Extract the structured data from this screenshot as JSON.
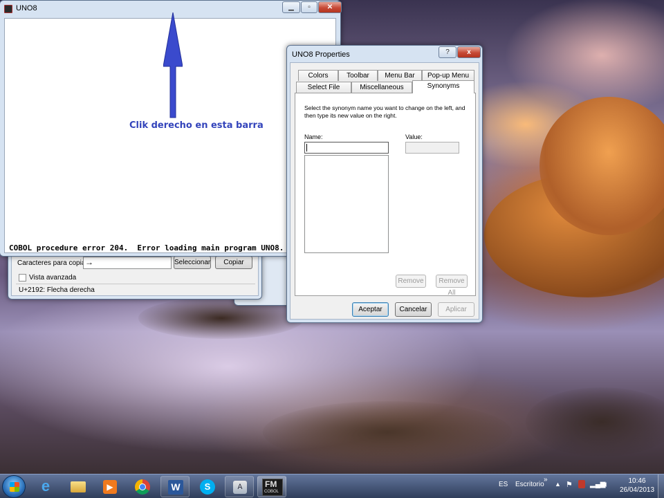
{
  "uno8_window": {
    "title": "UNO8",
    "error_text": "COBOL procedure error 204.  Error loading main program UNO8."
  },
  "annotation": {
    "text": "Clik derecho en esta barra"
  },
  "charmap_window": {
    "chars_label": "Caracteres para copiar:",
    "chars_value": "→",
    "select_button": "Seleccionar",
    "copy_button": "Copiar",
    "advanced_label": "Vista avanzada",
    "status_text": "U+2192: Flecha derecha"
  },
  "properties_dialog": {
    "title": "UNO8 Properties",
    "help_label": "?",
    "close_label": "x",
    "tabs_row1": [
      "Colors",
      "Toolbar",
      "Menu Bar",
      "Pop-up Menu"
    ],
    "tabs_row2": [
      "Select File",
      "Miscellaneous",
      "Synonyms"
    ],
    "instructions": "Select the synonym name you want to change on the left, and then type its new value on the right.",
    "name_label": "Name:",
    "value_label": "Value:",
    "remove_button": "Remove",
    "remove_all_button": "Remove All",
    "accept_button": "Aceptar",
    "cancel_button": "Cancelar",
    "apply_button": "Aplicar"
  },
  "taskbar": {
    "language": "ES",
    "desktop_label": "Escritorio",
    "time": "10:46",
    "date": "26/04/2013",
    "fm_icon_line1": "FM",
    "fm_icon_line2": "COBOL",
    "word_icon_letter": "W"
  },
  "colors": {
    "annotation_blue": "#3344bb",
    "close_red": "#c74a37"
  }
}
